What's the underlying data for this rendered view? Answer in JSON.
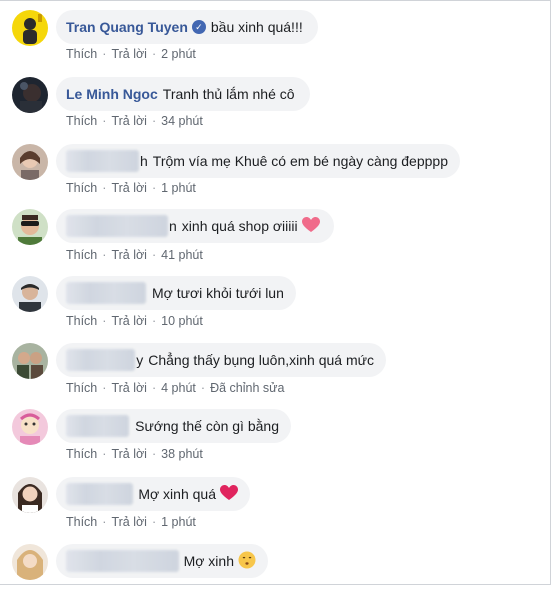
{
  "comments": [
    {
      "author": "Tran Quang Tuyen",
      "verified": true,
      "text": "bầu xinh quá!!!",
      "like": "Thích",
      "reply": "Trả lời",
      "time": "2 phút",
      "avatar": "yellow-avatar"
    },
    {
      "author": "Le Minh Ngoc",
      "verified": false,
      "text": "Tranh thủ lắm nhé cô",
      "like": "Thích",
      "reply": "Trả lời",
      "time": "34 phút",
      "avatar": "dark-avatar"
    },
    {
      "name_hint": "h",
      "text": "Trộm vía mẹ Khuê có em bé ngày càng đepppp",
      "like": "Thích",
      "reply": "Trả lời",
      "time": "1 phút",
      "avatar": "woman-avatar"
    },
    {
      "name_hint": "n",
      "text": "xinh quá shop ơiiiii",
      "emoji": "heart",
      "like": "Thích",
      "reply": "Trả lời",
      "time": "41 phút",
      "avatar": "sunglasses-avatar"
    },
    {
      "name_hint": "",
      "text": "Mợ tươi khỏi tưới lun",
      "like": "Thích",
      "reply": "Trả lời",
      "time": "10 phút",
      "avatar": "man-avatar"
    },
    {
      "name_hint": "y",
      "text": "Chẳng thấy bụng luôn,xinh quá mức",
      "like": "Thích",
      "reply": "Trả lời",
      "time": "4 phút",
      "edited": "Đã chỉnh sửa",
      "avatar": "couple-avatar"
    },
    {
      "name_hint": "",
      "text": "Sướng thế còn gì bằng",
      "like": "Thích",
      "reply": "Trả lời",
      "time": "38 phút",
      "avatar": "pink-avatar"
    },
    {
      "name_hint": "",
      "text": "Mợ xinh quá",
      "emoji": "heart",
      "like": "Thích",
      "reply": "Trả lời",
      "time": "1 phút",
      "avatar": "girl-avatar"
    },
    {
      "name_hint": "",
      "text": "Mợ xinh",
      "emoji": "kissing-face",
      "avatar": "blonde-avatar"
    }
  ],
  "colors": {
    "author": "#385898",
    "bubble": "#f2f3f5",
    "meta": "#606770",
    "heart": "#e0245e",
    "verified": "#4267b2"
  }
}
